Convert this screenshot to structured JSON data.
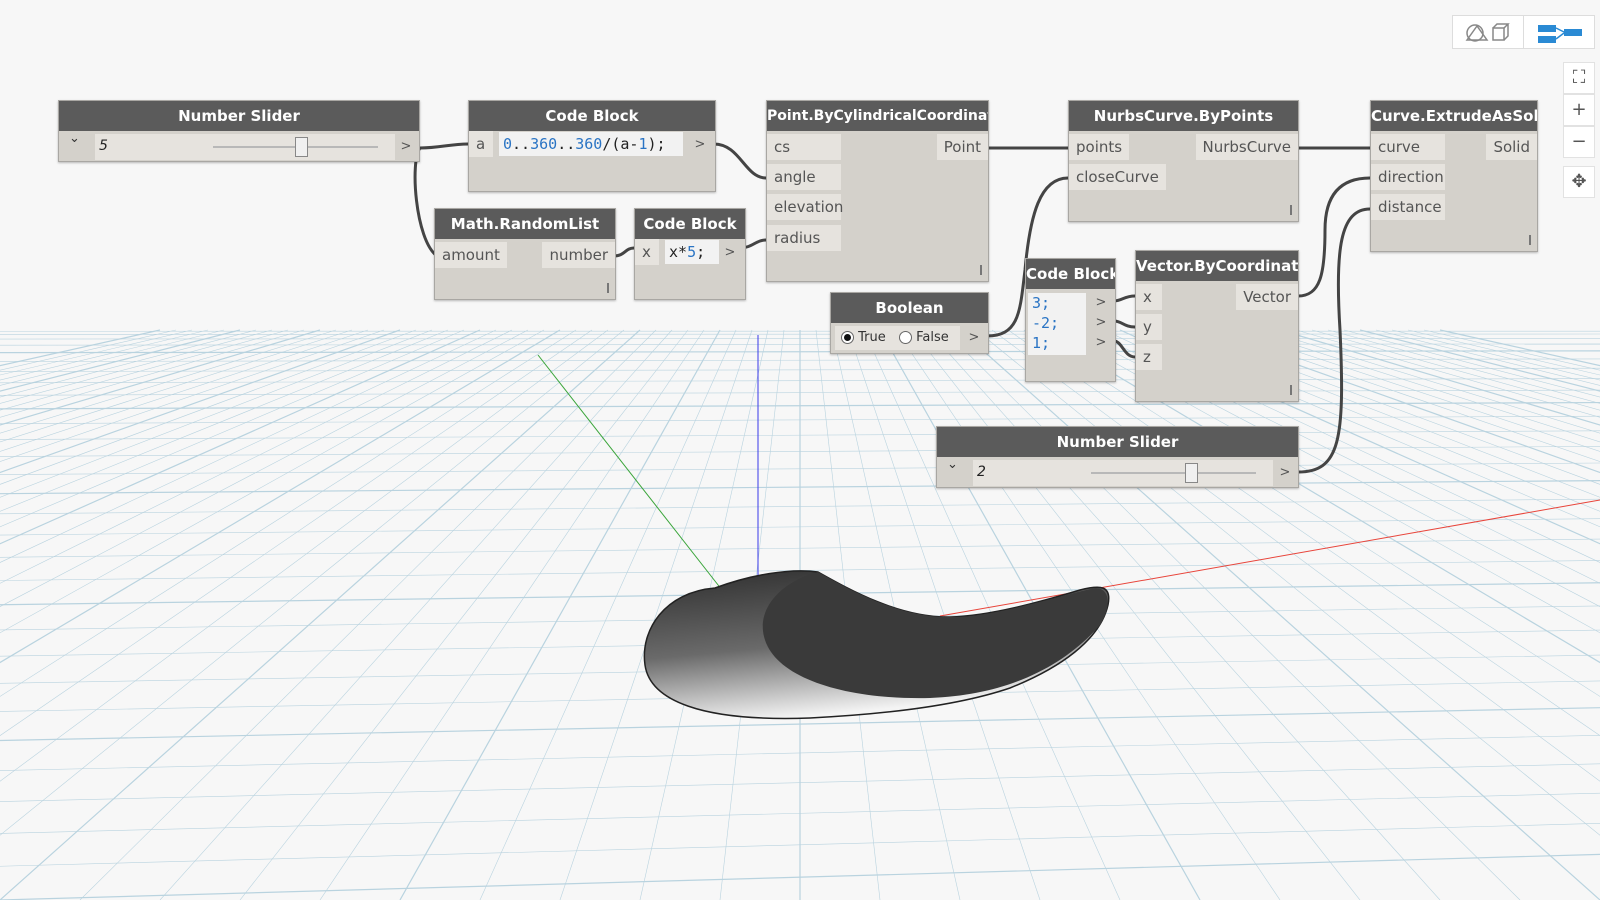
{
  "toolbar": {
    "geometry_view_icon": "geometry-view-icon",
    "graph_view_icon": "graph-view-icon",
    "zoom_fit_icon": "⛶",
    "zoom_in_icon": "+",
    "zoom_out_icon": "−",
    "pan_icon": "✥"
  },
  "nodes": {
    "slider1": {
      "title": "Number Slider",
      "value": "5",
      "chevron": "⌄",
      "arrow": ">"
    },
    "code1": {
      "title": "Code Block",
      "in": "a",
      "out": ">"
    },
    "random": {
      "title": "Math.RandomList",
      "in": "amount",
      "out": "number"
    },
    "code2": {
      "title": "Code Block",
      "in": "x",
      "code": "x*5;",
      "out": ">"
    },
    "point": {
      "title": "Point.ByCylindricalCoordinates",
      "inputs": [
        "cs",
        "angle",
        "elevation",
        "radius"
      ],
      "out": "Point"
    },
    "nurbs": {
      "title": "NurbsCurve.ByPoints",
      "inputs": [
        "points",
        "closeCurve"
      ],
      "out": "NurbsCurve"
    },
    "extrude": {
      "title": "Curve.ExtrudeAsSolid",
      "inputs": [
        "curve",
        "direction",
        "distance"
      ],
      "out": "Solid"
    },
    "boolean": {
      "title": "Boolean",
      "true_label": "True",
      "false_label": "False",
      "out": ">"
    },
    "code3": {
      "title": "Code Block",
      "lines": [
        "3;",
        "-2;",
        "1;"
      ],
      "outs": [
        ">",
        ">",
        ">"
      ]
    },
    "vector": {
      "title": "Vector.ByCoordinates",
      "inputs": [
        "x",
        "y",
        "z"
      ],
      "out": "Vector"
    },
    "slider2": {
      "title": "Number Slider",
      "value": "2",
      "chevron": "⌄",
      "arrow": ">"
    }
  },
  "colors": {
    "node_header": "#5b5b5b",
    "node_body": "#d4d1cb",
    "wire": "#444444",
    "number_literal": "#2a74c4",
    "grid": "#b9d3df",
    "axis_x": "#e8443a",
    "axis_y": "#3aa53a",
    "axis_z": "#3a3ae8",
    "toolbar_accent": "#2a8ad4"
  }
}
